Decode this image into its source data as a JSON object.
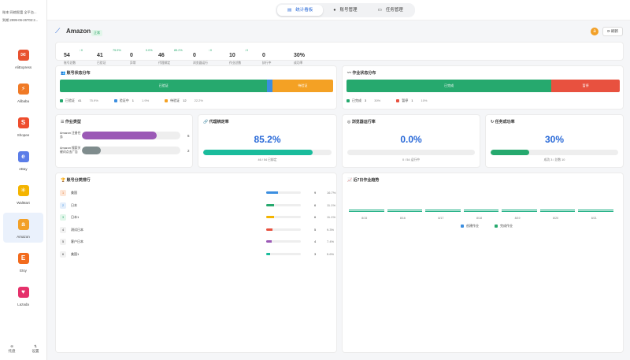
{
  "sidebar": {
    "header_line1": "账本  网络智富 全平台...",
    "header_line2": "到期  2999-06-26T02:2...",
    "items": [
      {
        "label": "AliExpress",
        "color": "#e8512f",
        "glyph": "✉"
      },
      {
        "label": "Alibaba",
        "color": "#f07a26",
        "glyph": "⚡"
      },
      {
        "label": "Shopee",
        "color": "#ee4d2d",
        "glyph": "S"
      },
      {
        "label": "eBay",
        "color": "#5b7de8",
        "glyph": "e"
      },
      {
        "label": "WalMart",
        "color": "#f4b400",
        "glyph": "✳"
      },
      {
        "label": "Amazon",
        "color": "#f2a027",
        "glyph": "a"
      },
      {
        "label": "Etsy",
        "color": "#f26b1d",
        "glyph": "E"
      },
      {
        "label": "Lazada",
        "color": "#e5316b",
        "glyph": "♥"
      }
    ],
    "active_item": "Amazon",
    "bottom": [
      {
        "label": "托盘",
        "icon": "tray-icon"
      },
      {
        "label": "设置",
        "icon": "settings-icon"
      }
    ]
  },
  "topnav": {
    "tabs": [
      {
        "label": "统计看板",
        "icon": "▤",
        "active": true
      },
      {
        "label": "账号管理",
        "icon": "●",
        "active": false
      },
      {
        "label": "任务管理",
        "icon": "▭",
        "active": false
      }
    ]
  },
  "header": {
    "title": "Amazon",
    "badge": "正常",
    "refresh": "刷新",
    "logo_glyph": "a"
  },
  "stats": [
    {
      "value": "54",
      "label": "账号总数",
      "pct": "↑0"
    },
    {
      "value": "41",
      "label": "已验证",
      "pct": "75.9%"
    },
    {
      "value": "0",
      "label": "异常",
      "pct": "0.0%"
    },
    {
      "value": "46",
      "label": "代理绑定",
      "pct": "85.2%"
    },
    {
      "value": "0",
      "label": "浏览器运行",
      "pct": "↑0"
    },
    {
      "value": "10",
      "label": "作业总数",
      "pct": "↑0"
    },
    {
      "value": "0",
      "label": "执行中",
      "pct": ""
    },
    {
      "value": "30%",
      "label": "成功率",
      "pct": ""
    }
  ],
  "account_status": {
    "title": "账号状态分布",
    "segments": [
      {
        "label": "已验证",
        "color": "#26a96e",
        "value": 41,
        "pct": "75.9%"
      },
      {
        "label": "验证中",
        "color": "#3b8ee0",
        "value": 1,
        "pct": "1.9%"
      },
      {
        "label": "待验证",
        "color": "#f4a124",
        "value": 12,
        "pct": "22.2%"
      }
    ],
    "bar_labels": [
      "已验证",
      "",
      "待验证"
    ]
  },
  "job_status": {
    "title": "作业状态分布",
    "segments": [
      {
        "label": "已完成",
        "color": "#26a96e",
        "value": 3,
        "pct": "30%"
      },
      {
        "label": "暂停",
        "color": "#e8513f",
        "value": 1,
        "pct": "10%"
      }
    ],
    "bar_labels": [
      "已完成",
      "暂停"
    ]
  },
  "job_types": {
    "title": "作业类型",
    "items": [
      {
        "name": "Amazon 注册任务",
        "count": "6",
        "fill": 0.76,
        "color": "#9b59b6"
      },
      {
        "name": "Amazon 搜索关键词点击广告",
        "count": "2",
        "fill": 0.19,
        "color": "#7f8c8d"
      }
    ]
  },
  "proxy": {
    "title": "代理绑定率",
    "value": "85.2%",
    "fill": 0.852,
    "sub": "46 / 54 已绑定",
    "color": "#1abc9c"
  },
  "browser": {
    "title": "浏览器运行率",
    "value": "0.0%",
    "fill": 0.0,
    "sub": "0 / 54 运行中",
    "color": "#3b8ee0"
  },
  "success": {
    "title": "任务成功率",
    "value": "30%",
    "fill": 0.3,
    "sub": "成功 3 / 总数 10",
    "color": "#26a96e"
  },
  "ranking": {
    "title": "账号分类排行",
    "rows": [
      {
        "rank": "1",
        "name": "美国",
        "count": "9",
        "pct": "16.7%",
        "fill": 0.167,
        "color": "#3b8ee0"
      },
      {
        "rank": "2",
        "name": "日本",
        "count": "6",
        "pct": "11.1%",
        "fill": 0.111,
        "color": "#26a96e"
      },
      {
        "rank": "3",
        "name": "日本1",
        "count": "6",
        "pct": "11.1%",
        "fill": 0.111,
        "color": "#f4b400"
      },
      {
        "rank": "4",
        "name": "测试日本",
        "count": "5",
        "pct": "9.3%",
        "fill": 0.093,
        "color": "#e8513f"
      },
      {
        "rank": "5",
        "name": "客户日本",
        "count": "4",
        "pct": "7.4%",
        "fill": 0.074,
        "color": "#9b59b6"
      },
      {
        "rank": "6",
        "name": "美国1",
        "count": "3",
        "pct": "5.6%",
        "fill": 0.056,
        "color": "#1abc9c"
      }
    ]
  },
  "trend": {
    "title": "近7日作业趋势",
    "days": [
      "8/15",
      "8/16",
      "8/17",
      "8/18",
      "8/19",
      "8/20",
      "8/21"
    ],
    "legend": [
      {
        "label": "创建作业",
        "color": "#3b8ee0"
      },
      {
        "label": "完成作业",
        "color": "#26a96e"
      }
    ]
  }
}
